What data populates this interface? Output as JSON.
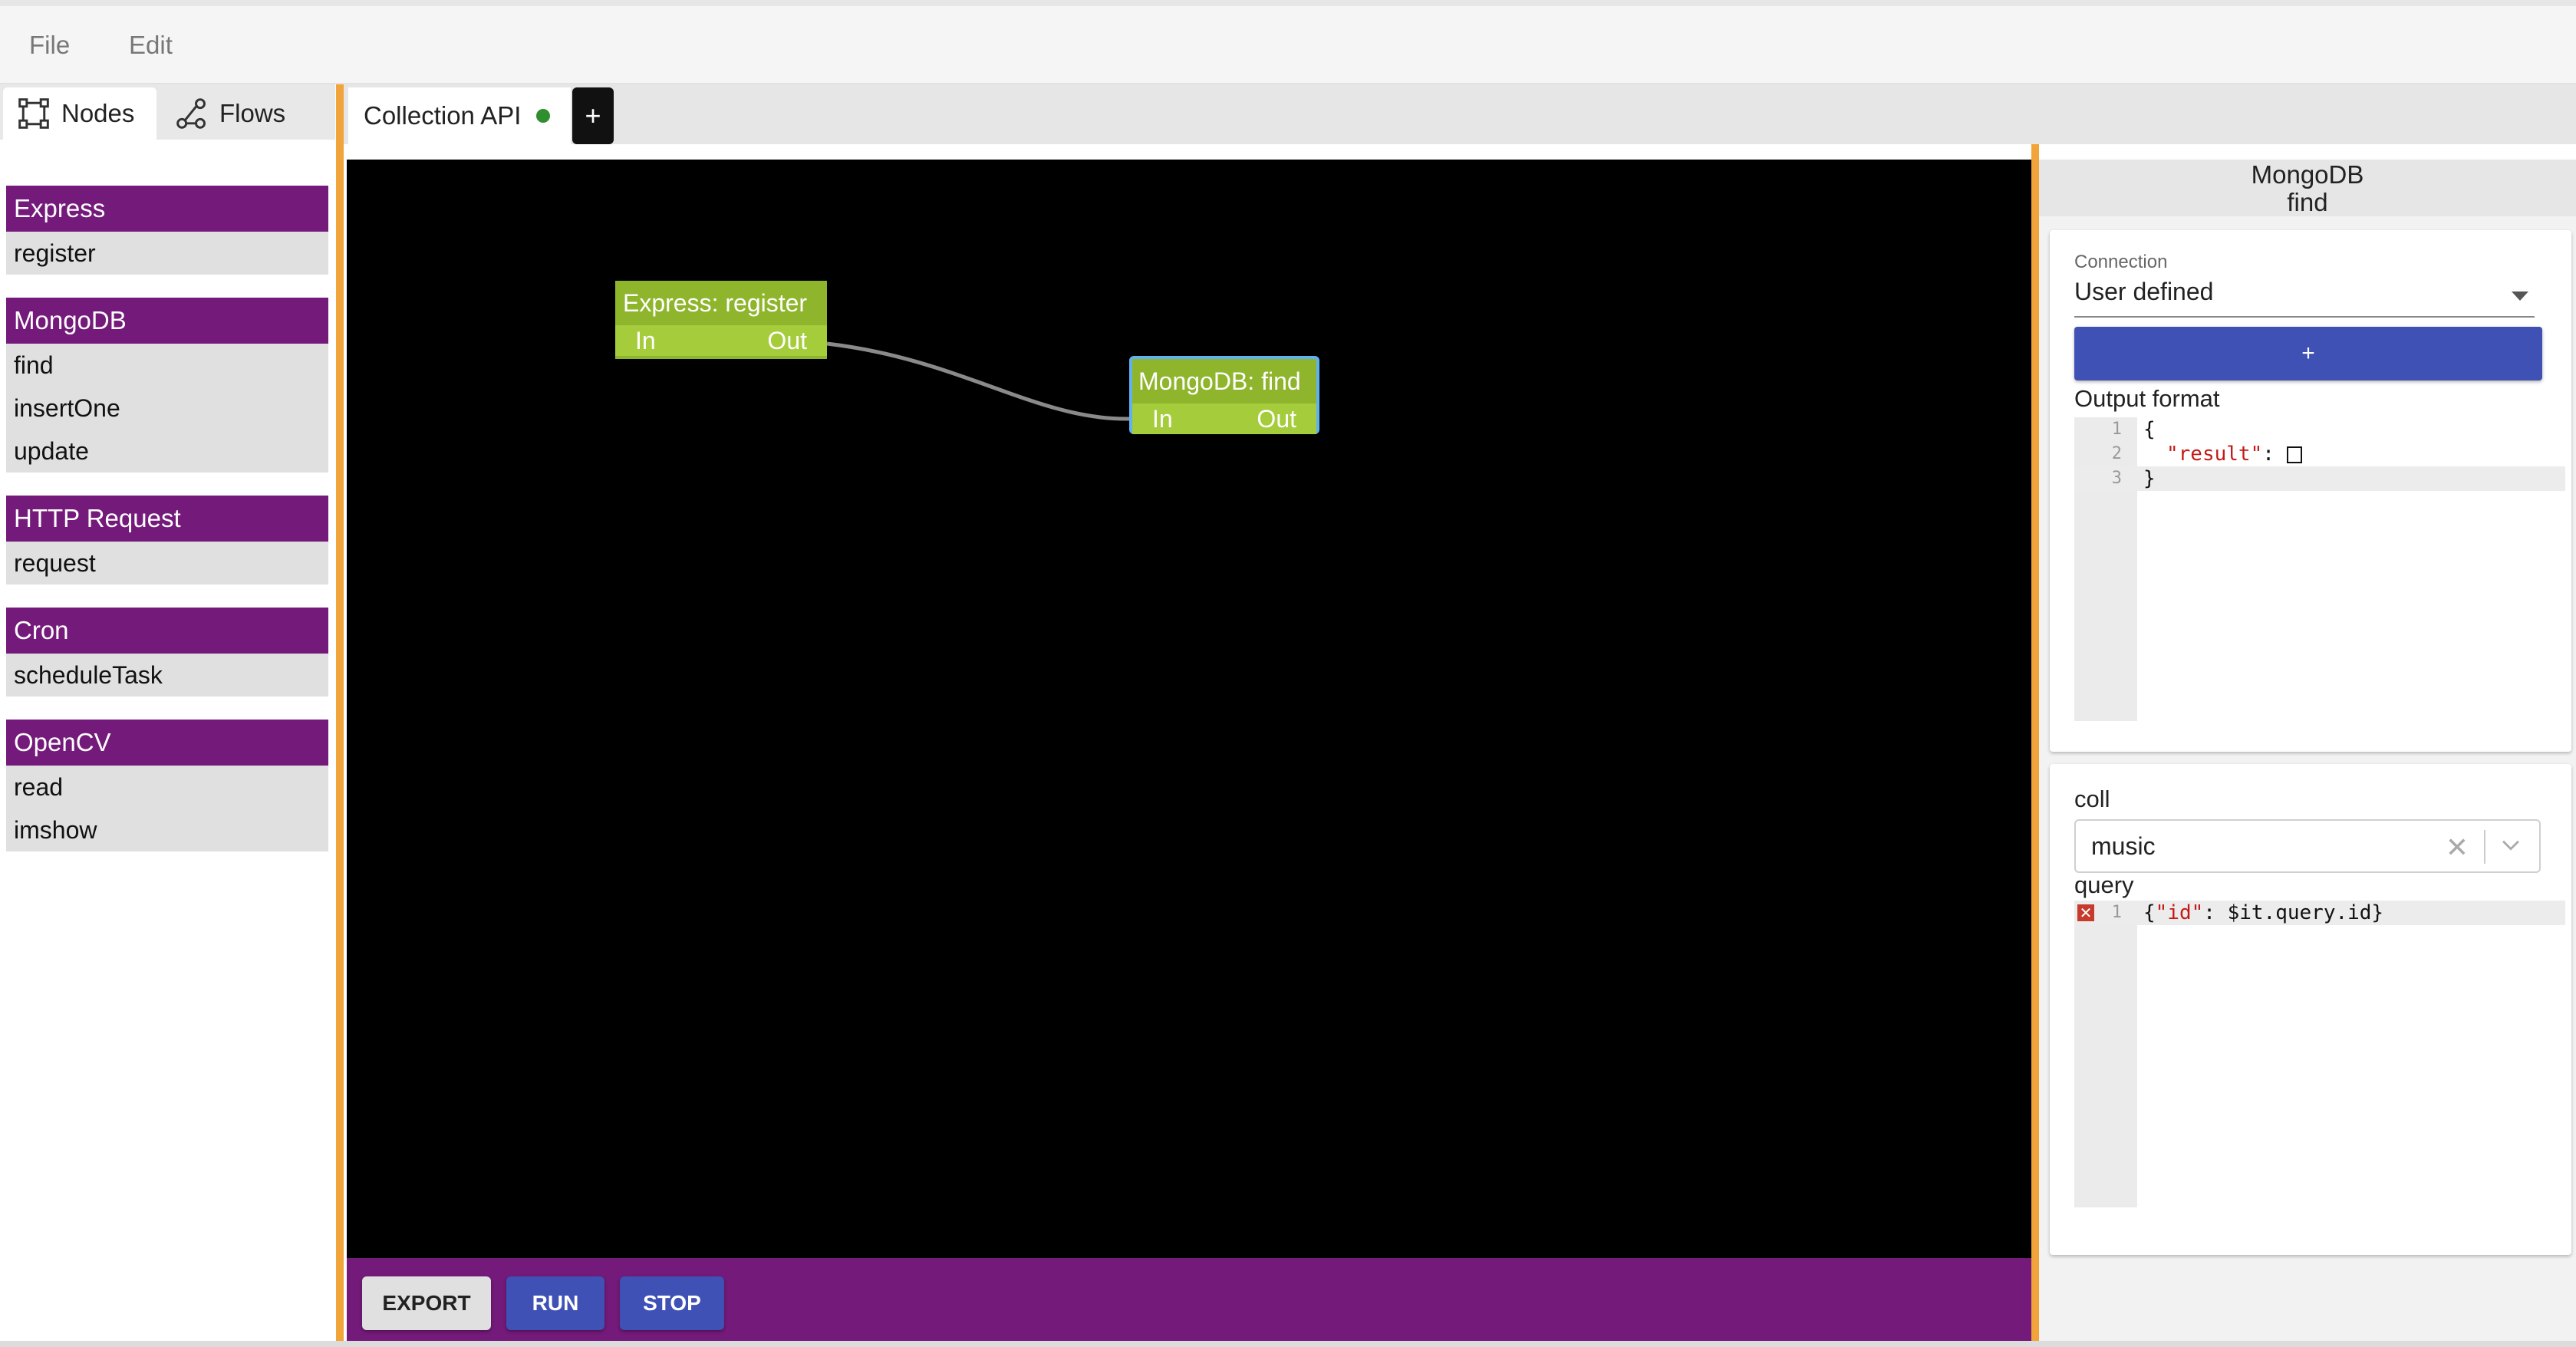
{
  "menu": {
    "file": "File",
    "edit": "Edit"
  },
  "left_panel": {
    "tabs": [
      {
        "label": "Nodes",
        "icon": "nodes-icon",
        "active": true
      },
      {
        "label": "Flows",
        "icon": "flows-icon",
        "active": false
      }
    ],
    "groups": [
      {
        "title": "Express",
        "items": [
          "register"
        ]
      },
      {
        "title": "MongoDB",
        "items": [
          "find",
          "insertOne",
          "update"
        ]
      },
      {
        "title": "HTTP Request",
        "items": [
          "request"
        ]
      },
      {
        "title": "Cron",
        "items": [
          "scheduleTask"
        ]
      },
      {
        "title": "OpenCV",
        "items": [
          "read",
          "imshow"
        ]
      }
    ]
  },
  "tabs": {
    "current": {
      "label": "Collection API",
      "status_color": "#2f8f2f"
    },
    "add_label": "+"
  },
  "canvas": {
    "nodes": [
      {
        "title": "Express: register",
        "in": "In",
        "out": "Out"
      },
      {
        "title": "MongoDB: find",
        "in": "In",
        "out": "Out",
        "selected": true
      }
    ]
  },
  "toolbar": {
    "export": "EXPORT",
    "run": "RUN",
    "stop": "STOP"
  },
  "right_panel": {
    "header_line1": "MongoDB",
    "header_line2": "find",
    "connection_label": "Connection",
    "connection_value": "User defined",
    "add_button": "+",
    "output_format_label": "Output format",
    "output_lines": [
      "1",
      "2",
      "3"
    ],
    "output_code": {
      "open": "{",
      "key": "\"result\"",
      "sep": ": ",
      "close": "}"
    },
    "coll_label": "coll",
    "coll_value": "music",
    "query_label": "query",
    "query_line_no": "1",
    "query_code": {
      "open": "{",
      "key": "\"id\"",
      "rest": ": $it.query.id}"
    }
  },
  "colors": {
    "group_header": "#741a7a",
    "separator": "#f0a43a",
    "node": "#8fb52c",
    "primary_button": "#3f51b5"
  }
}
